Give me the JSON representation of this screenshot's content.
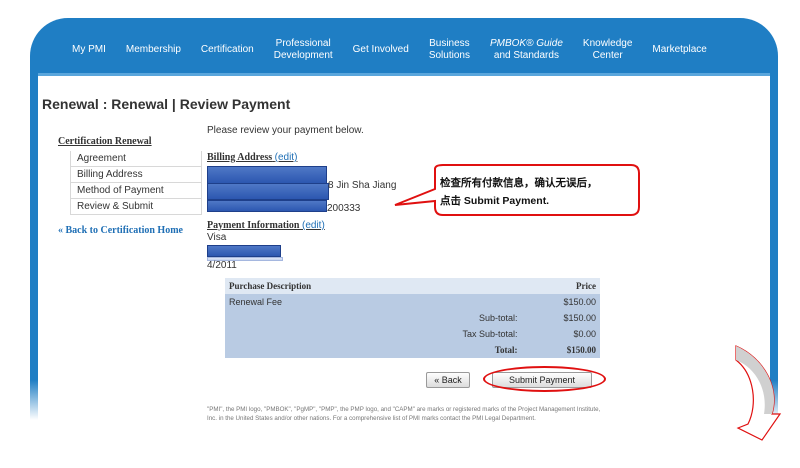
{
  "nav": {
    "items": [
      {
        "label": "My PMI"
      },
      {
        "label": "Membership"
      },
      {
        "label": "Certification"
      },
      {
        "label": "Professional\nDevelopment"
      },
      {
        "label": "Get Involved"
      },
      {
        "label": "Business\nSolutions"
      },
      {
        "label": "PMBOK® Guide",
        "label2": "and Standards"
      },
      {
        "label": "Knowledge\nCenter"
      },
      {
        "label": "Marketplace"
      }
    ]
  },
  "page_title": "Renewal : Renewal | Review Payment",
  "sidebar": {
    "heading": "Certification Renewal",
    "items": [
      "Agreement",
      "Billing Address",
      "Method of Payment",
      "Review & Submit"
    ],
    "back_link": "« Back to Certification Home"
  },
  "content": {
    "intro": "Please review your payment below.",
    "billing_heading": "Billing Address",
    "edit_label": "(edit)",
    "billing_line1_tail": "8 Jin Sha Jiang",
    "billing_line3_tail": "200333",
    "payment_heading": "Payment Information",
    "card_type": "Visa",
    "card_expiry": "4/2011"
  },
  "table": {
    "header_desc": "Purchase Description",
    "header_price": "Price",
    "item_desc": "Renewal Fee",
    "item_price": "$150.00",
    "subtotal_label": "Sub-total:",
    "subtotal_value": "$150.00",
    "tax_label": "Tax Sub-total:",
    "tax_value": "$0.00",
    "total_label": "Total:",
    "total_value": "$150.00"
  },
  "buttons": {
    "back": "« Back",
    "submit": "Submit Payment"
  },
  "legal": "\"PMI\", the PMI logo, \"PMBOK\", \"PgMP\", \"PMP\", the PMP logo, and \"CAPM\" are marks or registered marks of the Project Management Institute, Inc. in the United States and/or other nations. For a comprehensive list of PMI marks contact the PMI Legal Department.",
  "callout": {
    "line1": "检查所有付款信息，确认无误后，",
    "line2": "点击 Submit Payment."
  },
  "colors": {
    "brand_blue": "#1f7ec4",
    "link_blue": "#1f6fb5",
    "highlight_red": "#e01010"
  }
}
